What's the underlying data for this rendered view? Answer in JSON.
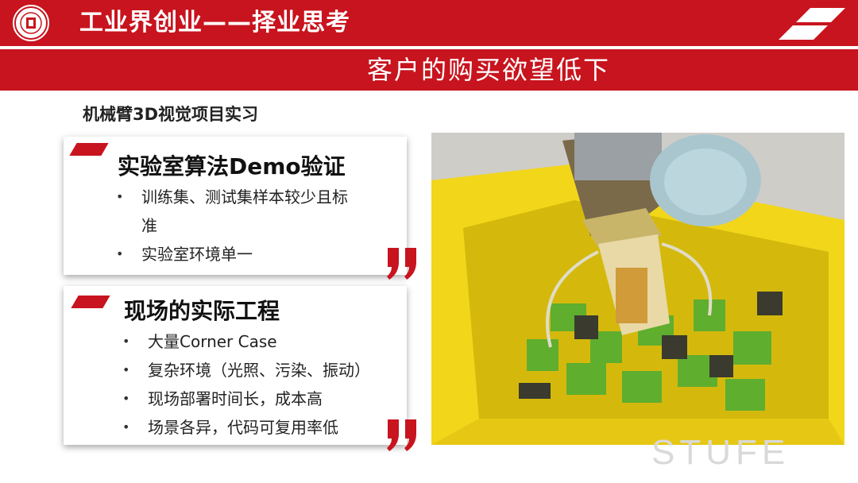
{
  "header": {
    "title": "工业界创业——择业思考",
    "subtitle": "客户的购买欲望低下"
  },
  "section": {
    "title": "机械臂3D视觉项目实习"
  },
  "cards": [
    {
      "title": "实验室算法Demo验证",
      "bullets": [
        "训练集、测试集样本较少且标准",
        "实验室环境单一"
      ]
    },
    {
      "title": "现场的实际工程",
      "bullets": [
        "大量Corner Case",
        "复杂环境（光照、污染、振动）",
        "现场部署时间长，成本高",
        "场景各异，代码可复用率低"
      ]
    }
  ],
  "watermark": "STUFE",
  "colors": {
    "brand_red": "#c8141e",
    "bin_yellow": "#f2d61a",
    "box_green": "#5fae2e"
  },
  "icons": [
    "university-logo-icon",
    "corner-stripe-icon",
    "quote-mark-icon",
    "robot-arm-photo"
  ]
}
